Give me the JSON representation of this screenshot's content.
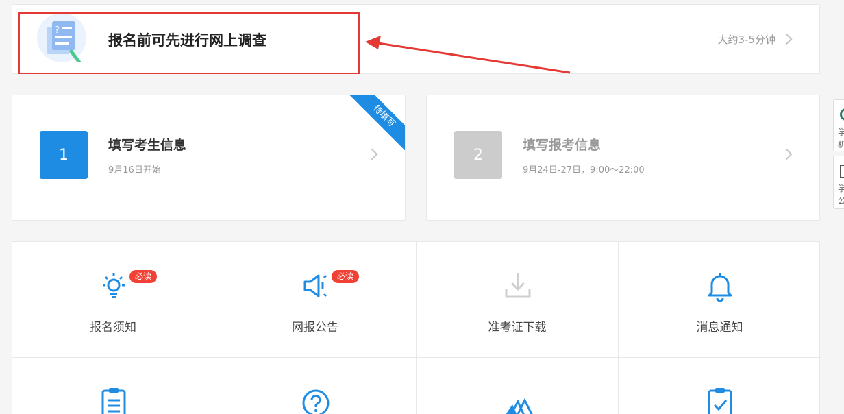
{
  "survey": {
    "title": "报名前可先进行网上调查",
    "time": "大约3-5分钟"
  },
  "steps": [
    {
      "number": "1",
      "title": "填写考生信息",
      "subtitle": "9月16日开始",
      "ribbon": "待填写"
    },
    {
      "number": "2",
      "title": "填写报考信息",
      "subtitle": "9月24日-27日，9:00～22:00"
    }
  ],
  "side": {
    "w1": [
      "学",
      "机"
    ],
    "w2": [
      "学",
      "公"
    ]
  },
  "menu": [
    {
      "label": "报名须知",
      "badge": "必读",
      "icon": "lightbulb-icon"
    },
    {
      "label": "网报公告",
      "badge": "必读",
      "icon": "megaphone-icon"
    },
    {
      "label": "准考证下载",
      "icon": "download-icon"
    },
    {
      "label": "消息通知",
      "icon": "bell-icon"
    },
    {
      "label": "",
      "icon": "clipboard-icon"
    },
    {
      "label": "",
      "icon": "question-icon"
    },
    {
      "label": "",
      "icon": "tickets-icon"
    },
    {
      "label": "",
      "icon": "checklist-icon"
    }
  ],
  "colors": {
    "accent": "#1f8ce4",
    "badge": "#f04134",
    "annotation": "#e53935"
  }
}
